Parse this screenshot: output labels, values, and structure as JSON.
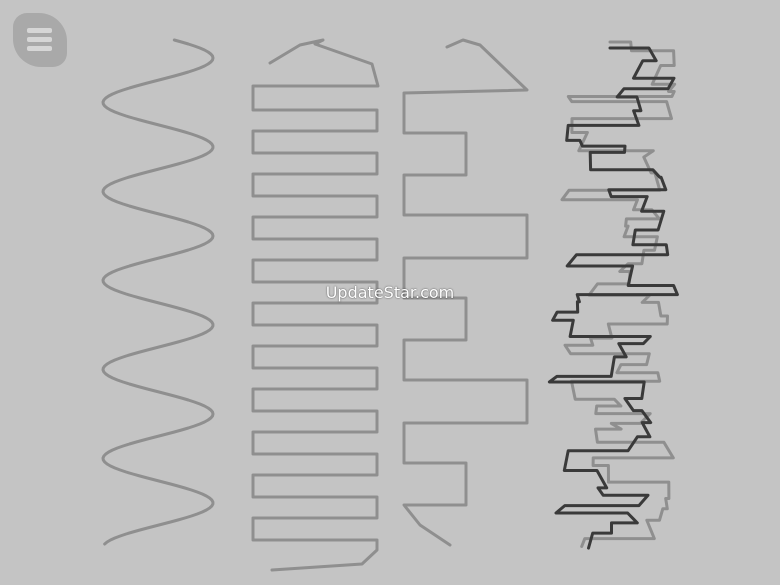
{
  "app": {
    "watermark": "UpdateStar.com"
  },
  "menu": {
    "icon": "hamburger-menu-icon"
  },
  "traces": [
    {
      "name": "sine-wave",
      "pattern": "sine",
      "color": "#8f8f8f"
    },
    {
      "name": "square-wave-dense",
      "pattern": "square-dense",
      "color": "#8f8f8f"
    },
    {
      "name": "square-wave-irregular",
      "pattern": "square-irregular",
      "color": "#8f8f8f"
    },
    {
      "name": "scribble-light",
      "pattern": "scribble",
      "color": "#8f8f8f"
    },
    {
      "name": "scribble-dark",
      "pattern": "scribble",
      "color": "#3a3a3a"
    }
  ],
  "colors": {
    "background": "#c4c4c4",
    "menu_button": "#a9a9a9",
    "trace_light": "#8f8f8f",
    "trace_dark": "#3a3a3a"
  }
}
